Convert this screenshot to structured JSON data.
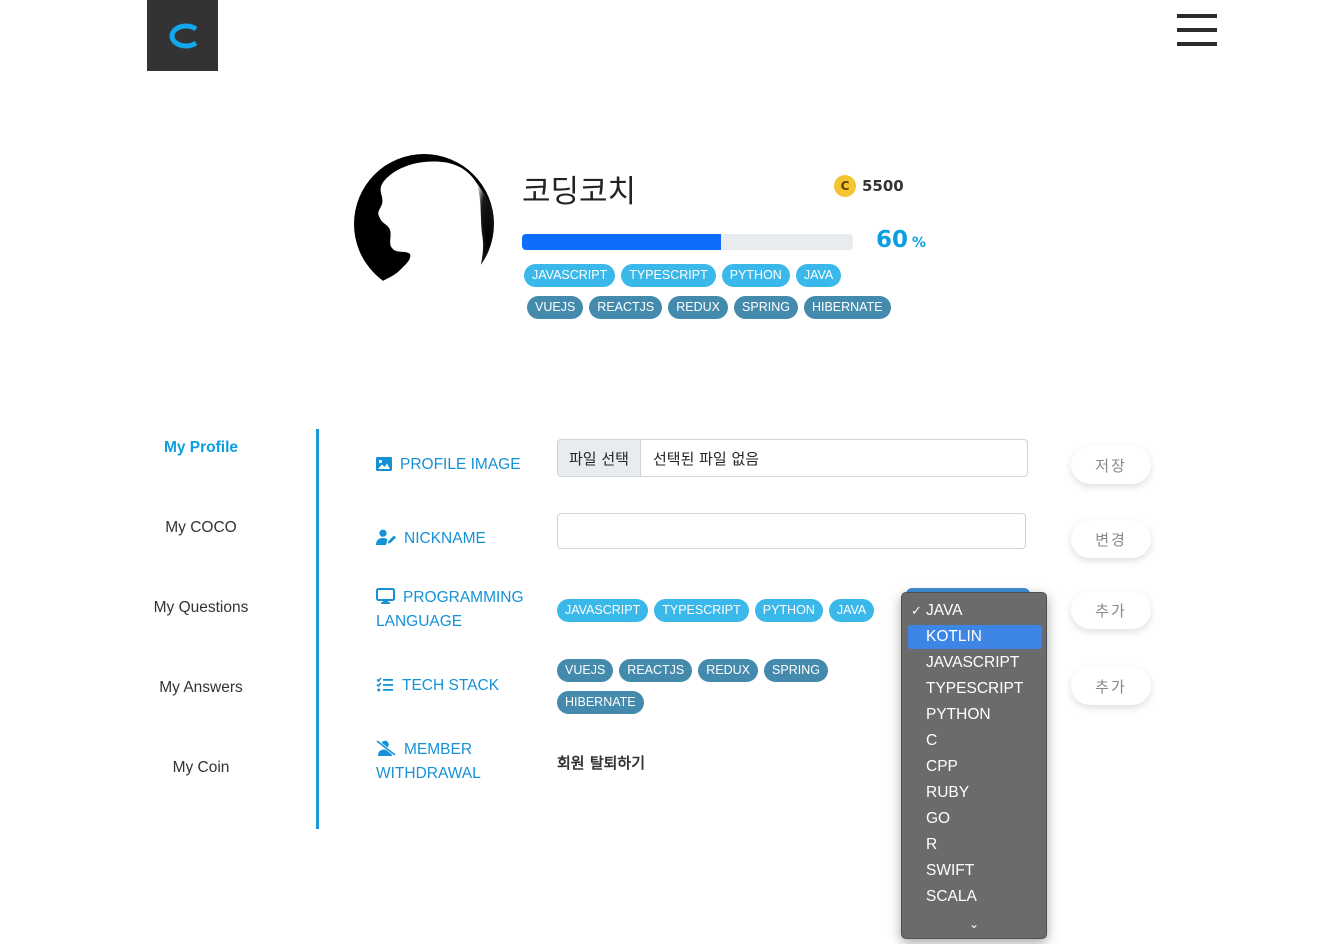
{
  "header": {
    "logo_letter": "C"
  },
  "profile": {
    "nickname": "코딩코치",
    "coin_letter": "C",
    "coin_amount": "5500",
    "progress": 60,
    "progress_value": "60",
    "progress_unit": "%",
    "languages": [
      "JAVASCRIPT",
      "TYPESCRIPT",
      "PYTHON",
      "JAVA"
    ],
    "tech_stack": [
      "VUEJS",
      "REACTJS",
      "REDUX",
      "SPRING",
      "HIBERNATE"
    ]
  },
  "sidebar": {
    "items": [
      {
        "label": "My Profile",
        "active": true
      },
      {
        "label": "My COCO"
      },
      {
        "label": "My Questions"
      },
      {
        "label": "My Answers"
      },
      {
        "label": "My Coin"
      }
    ]
  },
  "form": {
    "profile_image": {
      "label": "PROFILE IMAGE",
      "file_button": "파일 선택",
      "file_status": "선택된 파일 없음",
      "action": "저장"
    },
    "nickname": {
      "label": "NICKNAME",
      "value": "",
      "action": "변경"
    },
    "programming_language": {
      "label_line1": "PROGRAMMING",
      "label_line2": "LANGUAGE",
      "action": "추가"
    },
    "tech_stack": {
      "label": "TECH STACK",
      "action": "추가"
    },
    "member_withdrawal": {
      "label_line1": "MEMBER",
      "label_line2": "WITHDRAWAL",
      "action": "회원 탈퇴하기"
    }
  },
  "language_dropdown": {
    "selected": "JAVA",
    "highlighted": "KOTLIN",
    "options": [
      "JAVA",
      "KOTLIN",
      "JAVASCRIPT",
      "TYPESCRIPT",
      "PYTHON",
      "C",
      "CPP",
      "RUBY",
      "GO",
      "R",
      "SWIFT",
      "SCALA"
    ],
    "more_indicator": "⌄"
  },
  "colors": {
    "accent": "#0a9fe0",
    "progress_fill": "#0d6efd",
    "lang_badge": "#3bb8ea",
    "tech_badge": "#448aad",
    "coin": "#f5c431"
  }
}
